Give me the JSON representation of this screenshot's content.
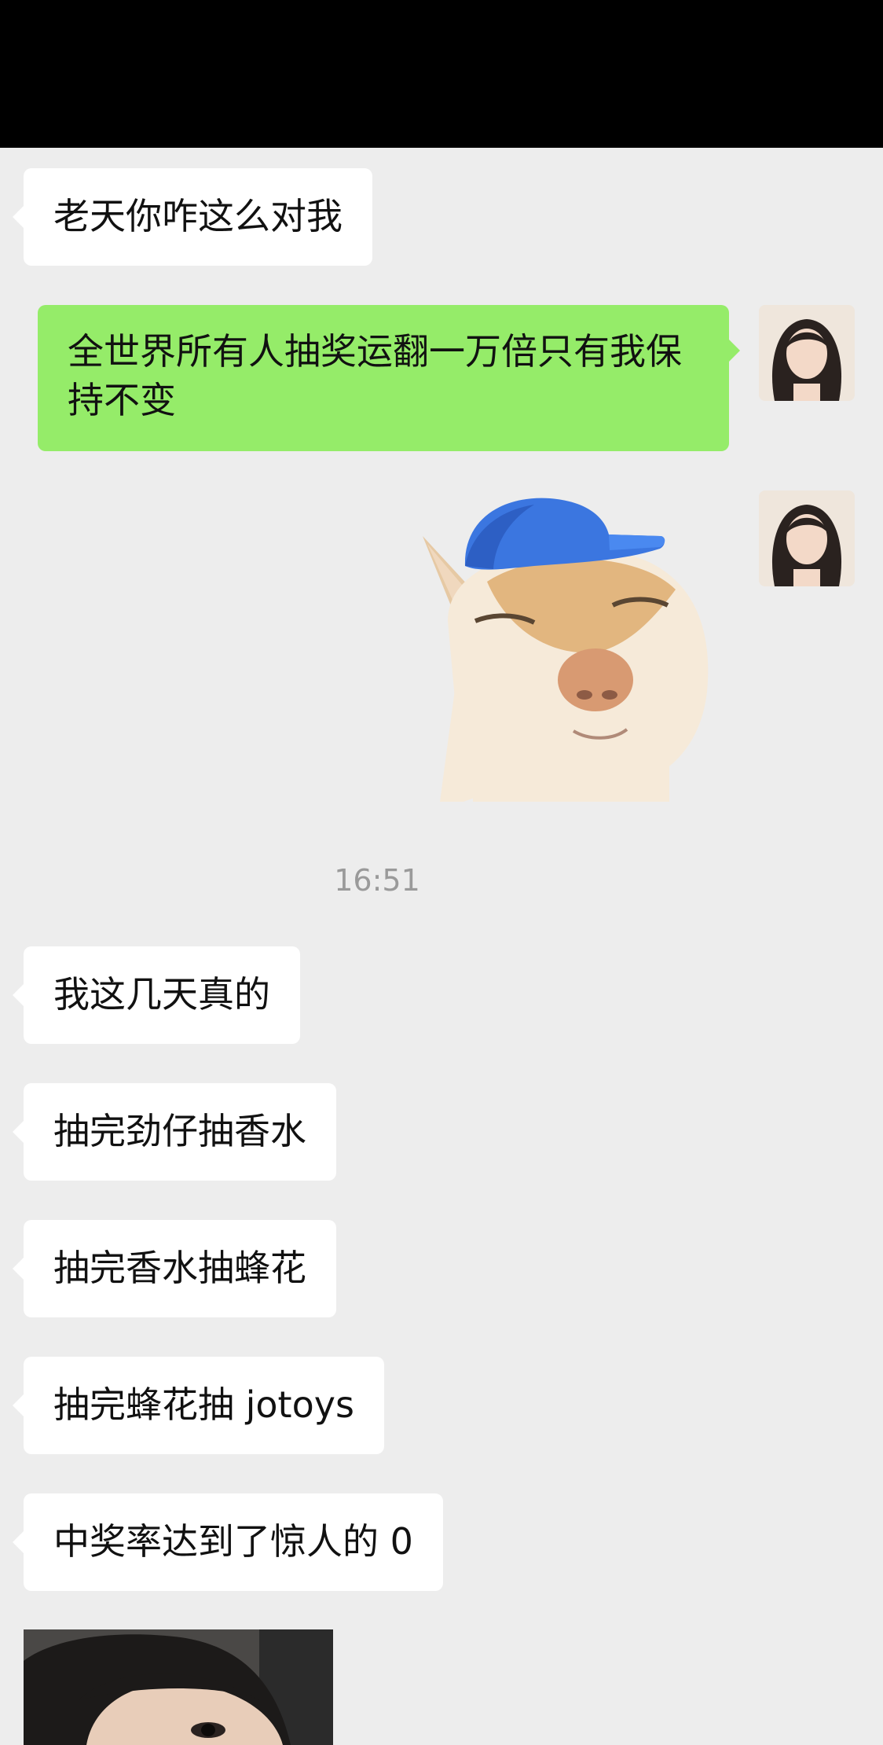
{
  "chat": {
    "timestamp": "16:51",
    "messages": [
      {
        "id": "m1",
        "side": "incoming",
        "text": "老天你咋这么对我"
      },
      {
        "id": "m2",
        "side": "outgoing",
        "text": "全世界所有人抽奖运翻一万倍只有我保持不变"
      },
      {
        "id": "m3",
        "side": "outgoing",
        "type": "sticker",
        "sticker": "cat-with-blue-cap"
      },
      {
        "id": "m4",
        "side": "incoming",
        "text": "我这几天真的"
      },
      {
        "id": "m5",
        "side": "incoming",
        "text": "抽完劲仔抽香水"
      },
      {
        "id": "m6",
        "side": "incoming",
        "text": "抽完香水抽蜂花"
      },
      {
        "id": "m7",
        "side": "incoming",
        "text": "抽完蜂花抽 jotoys"
      },
      {
        "id": "m8",
        "side": "incoming",
        "text": "中奖率达到了惊人的 0"
      },
      {
        "id": "m9",
        "side": "incoming",
        "type": "photo",
        "photo": "selfie-photo"
      }
    ]
  },
  "colors": {
    "background": "#ededed",
    "incoming_bubble": "#ffffff",
    "outgoing_bubble": "#95ec69",
    "top_bar": "#000000"
  }
}
